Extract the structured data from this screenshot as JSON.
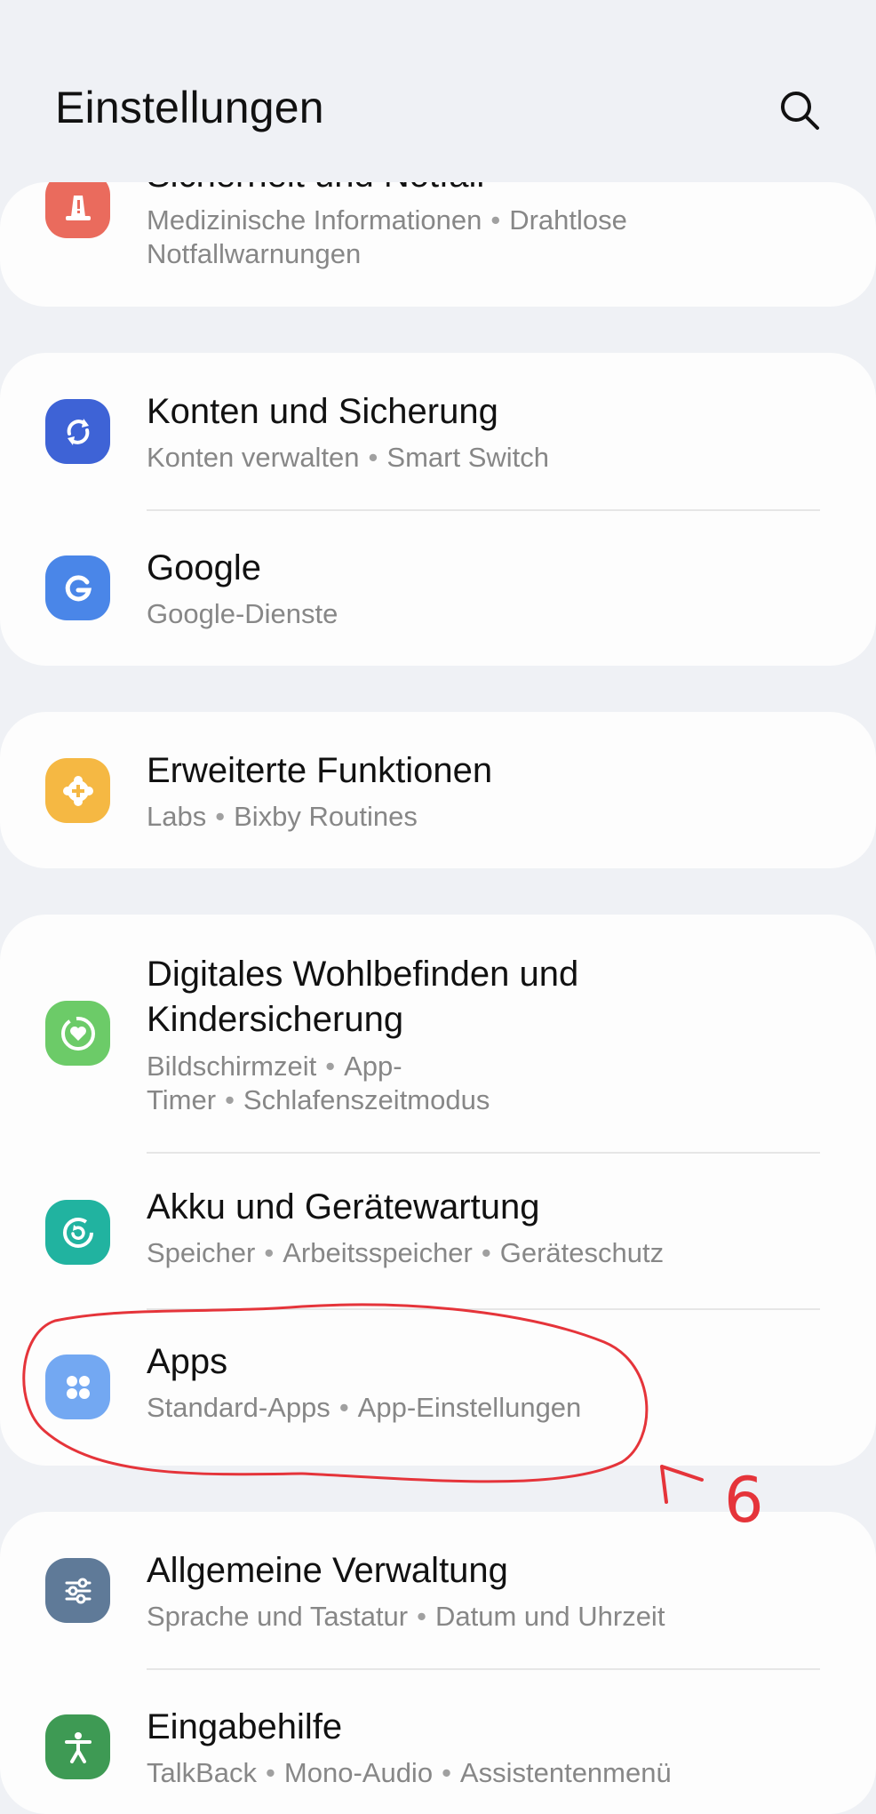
{
  "header": {
    "title": "Einstellungen",
    "search_icon": "search-icon"
  },
  "items": [
    {
      "title": "Sicherheit und Notfall",
      "subs": [
        "Medizinische Informationen",
        "Drahtlose Notfallwarnungen"
      ],
      "icon": "safety-alert-icon",
      "color": "#ea6b5d"
    },
    {
      "title": "Konten und Sicherung",
      "subs": [
        "Konten verwalten",
        "Smart Switch"
      ],
      "icon": "sync-icon",
      "color": "#3e63d6"
    },
    {
      "title": "Google",
      "subs": [
        "Google-Dienste"
      ],
      "icon": "google-icon",
      "color": "#4a86e8"
    },
    {
      "title": "Erweiterte Funktionen",
      "subs": [
        "Labs",
        "Bixby Routines"
      ],
      "icon": "puzzle-plus-icon",
      "color": "#f5b843"
    },
    {
      "title": "Digitales Wohlbefinden und Kindersicherung",
      "subs": [
        "Bildschirmzeit",
        "App-Timer",
        "Schlafenszeitmodus"
      ],
      "icon": "heart-ring-icon",
      "color": "#6ccb68"
    },
    {
      "title": "Akku und Gerätewartung",
      "subs": [
        "Speicher",
        "Arbeitsspeicher",
        "Geräteschutz"
      ],
      "icon": "device-care-icon",
      "color": "#21b3a0"
    },
    {
      "title": "Apps",
      "subs": [
        "Standard-Apps",
        "App-Einstellungen"
      ],
      "icon": "apps-grid-icon",
      "color": "#73a8f2"
    },
    {
      "title": "Allgemeine Verwaltung",
      "subs": [
        "Sprache und Tastatur",
        "Datum und Uhrzeit"
      ],
      "icon": "sliders-icon",
      "color": "#5f7a98"
    },
    {
      "title": "Eingabehilfe",
      "subs": [
        "TalkBack",
        "Mono-Audio",
        "Assistentenmenü"
      ],
      "icon": "accessibility-icon",
      "color": "#3e9a54"
    }
  ],
  "annotation": {
    "number": "6",
    "color": "#e5343a"
  }
}
